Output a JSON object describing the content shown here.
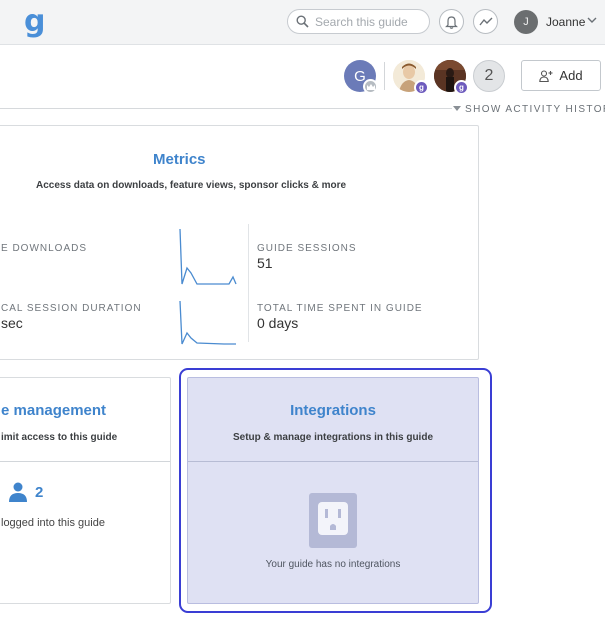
{
  "header": {
    "logo": "g",
    "search_placeholder": "Search this guide",
    "user_initial": "J",
    "user_name": "Joanne"
  },
  "collaborators": {
    "first_initial": "G",
    "badge_letter": "g",
    "more_count": "2",
    "add_label": "Add",
    "activity_label": "SHOW ACTIVITY HISTORY"
  },
  "metrics": {
    "title": "Metrics",
    "subtitle": "Access data on downloads, feature views, sponsor clicks & more",
    "stats": [
      {
        "label": "E DOWNLOADS",
        "value": ""
      },
      {
        "label": "GUIDE SESSIONS",
        "value": "51"
      },
      {
        "label": "CAL SESSION DURATION",
        "value": "sec"
      },
      {
        "label": "TOTAL TIME SPENT IN GUIDE",
        "value": "0 days"
      }
    ]
  },
  "access": {
    "title": "e management",
    "subtitle": "imit access to this guide",
    "count": "2",
    "caption": "logged into this guide"
  },
  "integrations": {
    "title": "Integrations",
    "subtitle": "Setup & manage integrations in this guide",
    "empty_text": "Your guide has no integrations"
  },
  "colors": {
    "accent": "#3f84cc",
    "highlight_border": "#3a3ed4",
    "integrations_bg": "#dfe1f3"
  }
}
